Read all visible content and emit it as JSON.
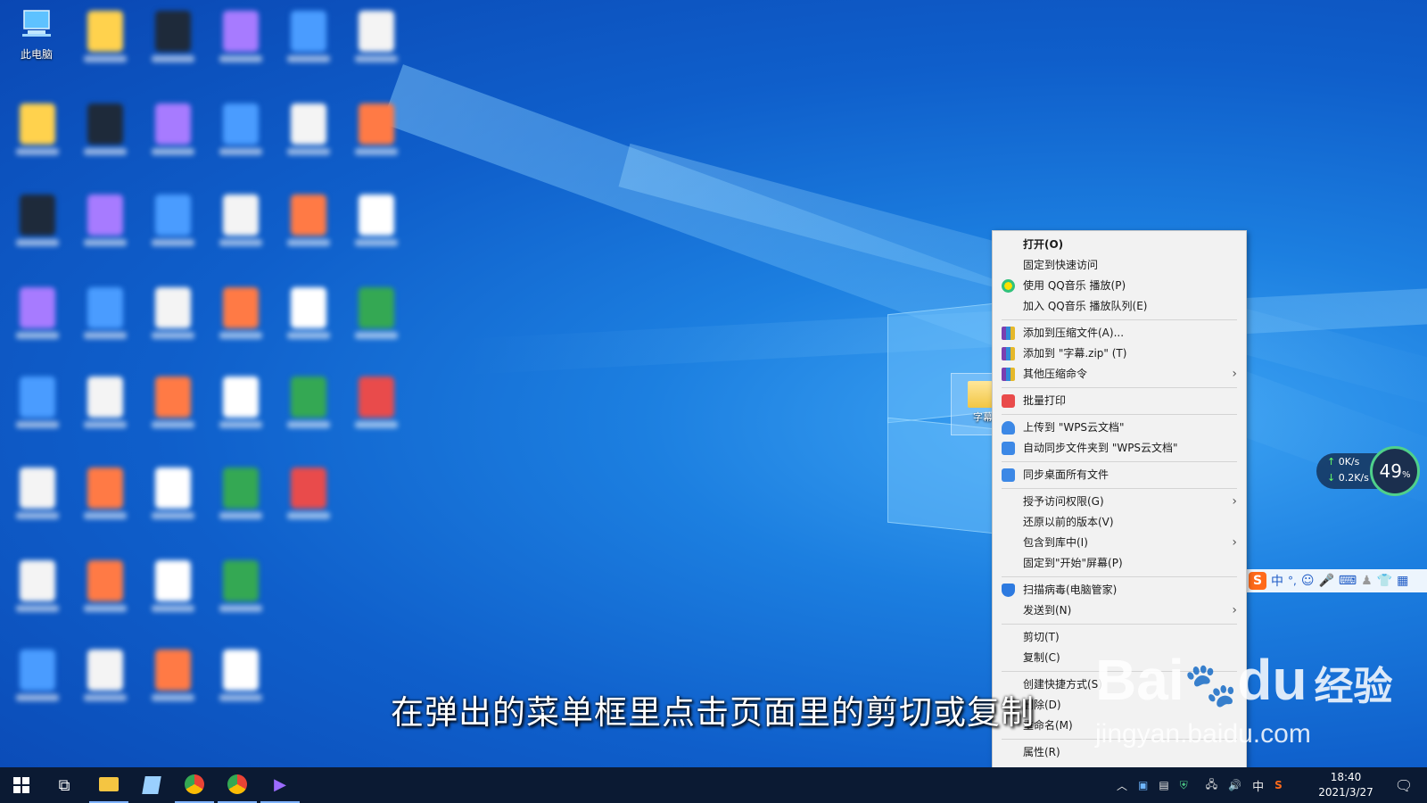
{
  "desktop": {
    "this_pc_label": "此电脑",
    "folder_label_partial": "字幕"
  },
  "context_menu": {
    "groups": [
      [
        {
          "label": "打开(O)",
          "bold": true,
          "icon": "none"
        },
        {
          "label": "固定到快速访问",
          "icon": "none"
        },
        {
          "label": "使用 QQ音乐 播放(P)",
          "icon": "qq-music-icon"
        },
        {
          "label": "加入 QQ音乐 播放队列(E)",
          "icon": "none"
        }
      ],
      [
        {
          "label": "添加到压缩文件(A)...",
          "icon": "winrar-icon"
        },
        {
          "label": "添加到 \"字幕.zip\" (T)",
          "icon": "winrar-icon"
        },
        {
          "label": "其他压缩命令",
          "icon": "winrar-icon",
          "submenu": true
        }
      ],
      [
        {
          "label": "批量打印",
          "icon": "printer-icon"
        }
      ],
      [
        {
          "label": "上传到 \"WPS云文档\"",
          "icon": "cloud-upload-icon"
        },
        {
          "label": "自动同步文件夹到 \"WPS云文档\"",
          "icon": "wps-sync-icon"
        }
      ],
      [
        {
          "label": "同步桌面所有文件",
          "icon": "wps-sync-icon"
        }
      ],
      [
        {
          "label": "授予访问权限(G)",
          "icon": "none",
          "submenu": true
        },
        {
          "label": "还原以前的版本(V)",
          "icon": "none"
        },
        {
          "label": "包含到库中(I)",
          "icon": "none",
          "submenu": true
        },
        {
          "label": "固定到\"开始\"屏幕(P)",
          "icon": "none"
        }
      ],
      [
        {
          "label": "扫描病毒(电脑管家)",
          "icon": "shield-icon"
        },
        {
          "label": "发送到(N)",
          "icon": "none",
          "submenu": true
        }
      ],
      [
        {
          "label": "剪切(T)",
          "icon": "none"
        },
        {
          "label": "复制(C)",
          "icon": "none"
        }
      ],
      [
        {
          "label": "创建快捷方式(S)",
          "icon": "none"
        },
        {
          "label": "删除(D)",
          "icon": "none"
        },
        {
          "label": "重命名(M)",
          "icon": "none"
        }
      ],
      [
        {
          "label": "属性(R)",
          "icon": "none"
        }
      ]
    ]
  },
  "net_widget": {
    "up": "0K/s",
    "down": "0.2K/s",
    "percent": "49",
    "percent_unit": "%"
  },
  "ime_bar": {
    "mode": "中",
    "punct": "°,"
  },
  "taskbar": {
    "tray_lang": "中",
    "time": "18:40",
    "date": "2021/3/27"
  },
  "subtitle": "在弹出的菜单框里点击页面里的剪切或复制",
  "watermark": {
    "brand": "Bai",
    "brand2": "du",
    "brand_cn": "经验",
    "url": "jingyan.baidu.com"
  },
  "colors": {
    "desktop_bg": "#0f5fcb",
    "taskbar_bg": "#0b1a33",
    "menu_bg": "#f2f2f2"
  }
}
